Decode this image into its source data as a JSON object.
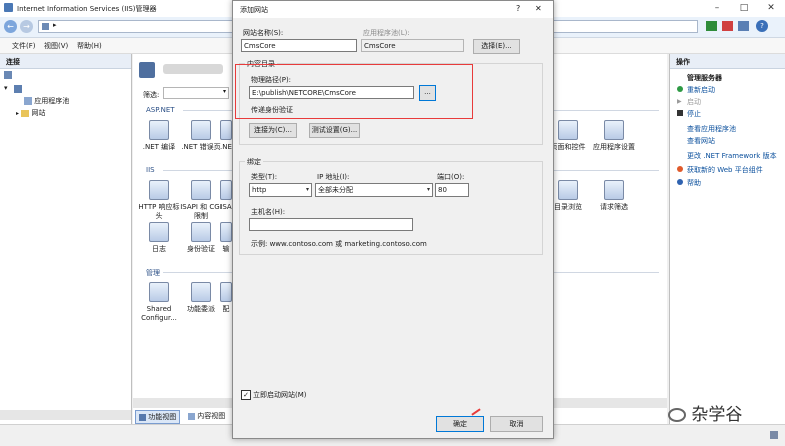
{
  "iis": {
    "window_title": "Internet Information Services (IIS)管理器",
    "menu": [
      "文件(F)",
      "视图(V)",
      "帮助(H)"
    ],
    "connections": {
      "header": "连接",
      "tree": [
        "应用程序池",
        "网站"
      ]
    },
    "center": {
      "filter_label": "筛选:",
      "sections": [
        {
          "label": "ASP.NET",
          "features": [
            ".NET 编译",
            ".NET 错误页",
            ".NE"
          ]
        },
        {
          "label": "IIS",
          "features": [
            "HTTP 响应标头",
            "ISAPI 和 CGI 限制",
            "ISA",
            "日志",
            "身份验证",
            "输"
          ]
        },
        {
          "label": "管理",
          "features": [
            "Shared Configur...",
            "功能委派",
            "配"
          ]
        }
      ],
      "right_features": [
        "页面和控件",
        "应用程序设置",
        "目录浏览",
        "请求筛选"
      ]
    },
    "tabs": {
      "features_view": "功能视图",
      "content_view": "内容视图"
    },
    "actions": {
      "header": "操作",
      "group_title": "管理服务器",
      "items": [
        "重新启动",
        "启动",
        "停止",
        "查看应用程序池",
        "查看网站",
        "更改 .NET Framework 版本",
        "获取新的 Web 平台组件",
        "帮助"
      ]
    }
  },
  "dialog": {
    "title": "添加网站",
    "site_name_label": "网站名称(S):",
    "site_name_value": "CmsCore",
    "app_pool_label": "应用程序池(L):",
    "app_pool_value": "CmsCore",
    "select_button": "选择(E)...",
    "content_dir_label": "内容目录",
    "physical_path_label": "物理路径(P):",
    "physical_path_value": "E:\\publish\\NETCORE\\CmsCore",
    "browse_button": "...",
    "pass_through_label": "传递身份验证",
    "connect_as_button": "连接为(C)...",
    "test_settings_button": "测试设置(G)...",
    "binding_label": "绑定",
    "type_label": "类型(T):",
    "type_value": "http",
    "ip_label": "IP 地址(I):",
    "ip_value": "全部未分配",
    "port_label": "端口(O):",
    "port_value": "80",
    "hostname_label": "主机名(H):",
    "hostname_value": "",
    "example_text": "示例: www.contoso.com 或 marketing.contoso.com",
    "start_now_label": "立即启动网站(M)",
    "ok_button": "确定",
    "cancel_button": "取消"
  },
  "watermark": "杂学谷"
}
